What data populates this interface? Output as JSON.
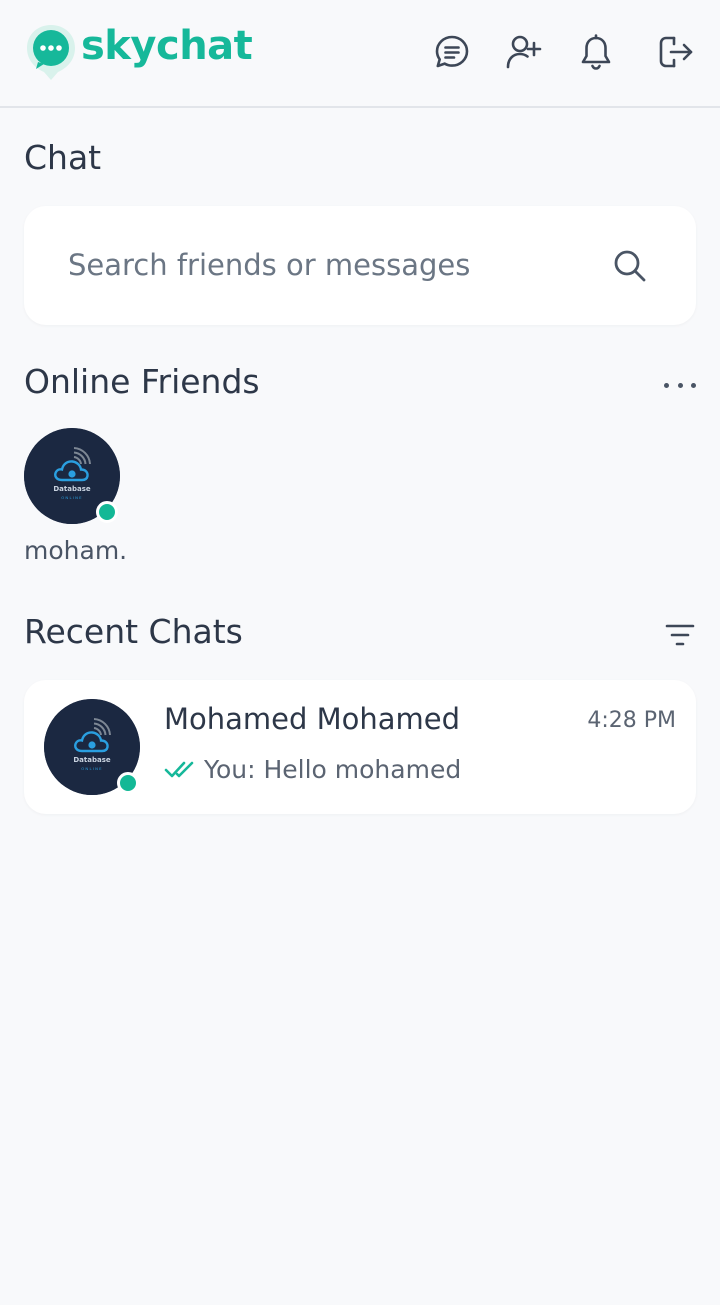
{
  "app": {
    "logo_text": "skychat",
    "brand_color": "#16b89a",
    "status_online_color": "#13b896"
  },
  "header": {
    "icons": [
      "chat-bubble-icon",
      "add-user-icon",
      "bell-icon",
      "logout-icon"
    ]
  },
  "page": {
    "title": "Chat"
  },
  "search": {
    "placeholder": "Search friends or messages",
    "value": ""
  },
  "online_friends": {
    "title": "Online Friends",
    "items": [
      {
        "name": "moham.",
        "status": "online",
        "avatar": "Database Online"
      }
    ]
  },
  "recent_chats": {
    "title": "Recent Chats",
    "items": [
      {
        "name": "Mohamed Mohamed",
        "time": "4:28 PM",
        "preview": "You: Hello mohamed",
        "read_receipt": "double-check-icon",
        "status": "online"
      }
    ]
  },
  "avatar_art": {
    "line1": "Database",
    "line2": "ONLINE"
  }
}
